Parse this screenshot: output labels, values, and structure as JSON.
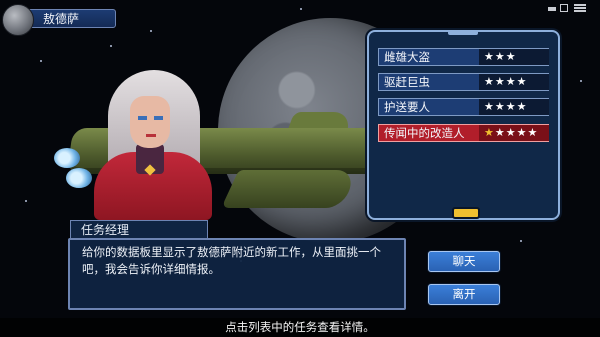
{
  "location": {
    "name": "敖德萨",
    "icon": "planet-icon"
  },
  "jobs": [
    {
      "name": "雌雄大盗",
      "stars": "★★★",
      "extra_star": "",
      "selected": false
    },
    {
      "name": "驱赶巨虫",
      "stars": "★★★★",
      "extra_star": "",
      "selected": false
    },
    {
      "name": "护送要人",
      "stars": "★★★★",
      "extra_star": "",
      "selected": false
    },
    {
      "name": "传闻中的改造人",
      "stars": "★★★★",
      "extra_star": "★",
      "selected": true
    }
  ],
  "dialogue": {
    "speaker": "任务经理",
    "text": "给你的数据板里显示了敖德萨附近的新工作，从里面挑一个吧，我会告诉你详细情报。"
  },
  "buttons": {
    "chat": "聊天",
    "leave": "离开"
  },
  "hint": "点击列表中的任务查看详情。",
  "colors": {
    "panel_bg": "#102848",
    "panel_border": "#8eb0dc",
    "selected_job": "#b11e2a",
    "button": "#2a62b4",
    "star_gold": "#f0c030"
  }
}
